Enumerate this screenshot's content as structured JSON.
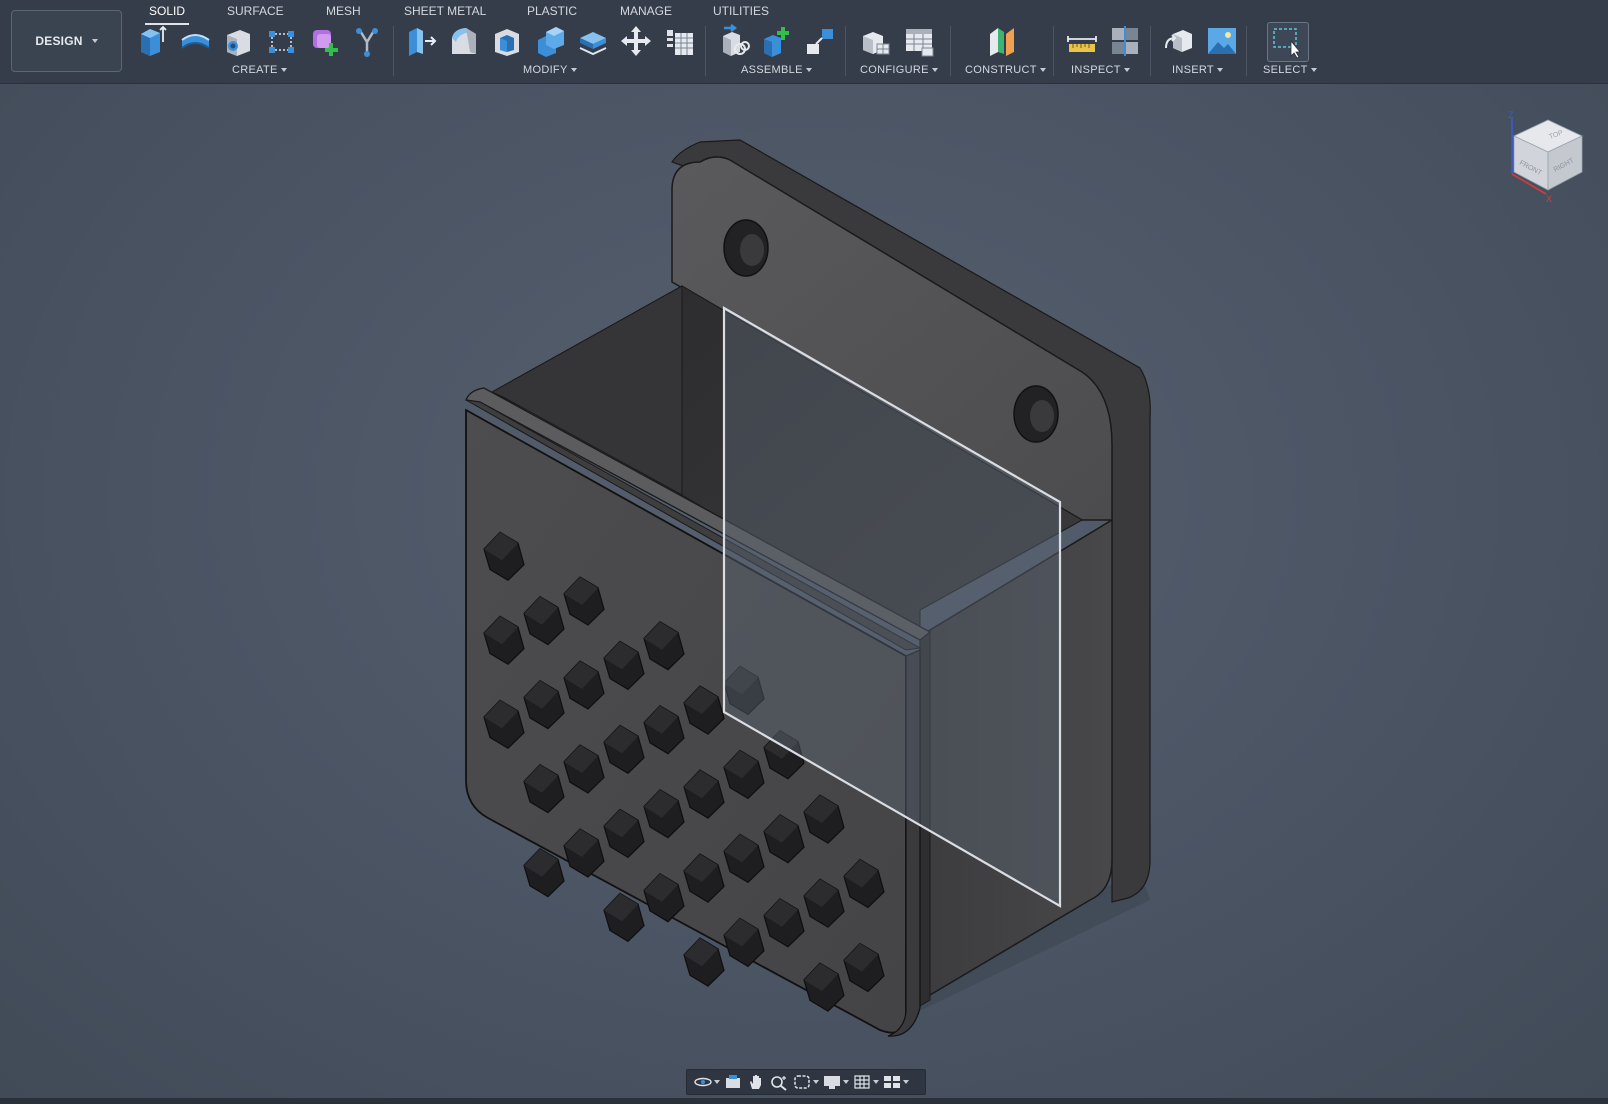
{
  "workspace": {
    "label": "DESIGN"
  },
  "tabs": [
    {
      "label": "SOLID",
      "active": true
    },
    {
      "label": "SURFACE",
      "active": false
    },
    {
      "label": "MESH",
      "active": false
    },
    {
      "label": "SHEET METAL",
      "active": false
    },
    {
      "label": "PLASTIC",
      "active": false
    },
    {
      "label": "MANAGE",
      "active": false
    },
    {
      "label": "UTILITIES",
      "active": false
    }
  ],
  "groups": {
    "create": "CREATE",
    "modify": "MODIFY",
    "assemble": "ASSEMBLE",
    "configure": "CONFIGURE",
    "construct": "CONSTRUCT",
    "inspect": "INSPECT",
    "insert": "INSERT",
    "select": "SELECT"
  },
  "tools": {
    "create": [
      "new-component-icon",
      "extrude-icon",
      "revolve-icon",
      "hole-icon",
      "pattern-icon",
      "create-form-icon",
      "fillet-branch-icon"
    ],
    "modify": [
      "press-pull-icon",
      "fillet-icon",
      "shell-icon",
      "combine-icon",
      "offset-face-icon",
      "move-icon",
      "parameters-icon"
    ],
    "assemble": [
      "joint-icon",
      "new-component-assemble-icon",
      "as-built-joint-icon"
    ],
    "configure": [
      "configure-icon",
      "table-icon"
    ],
    "construct": [
      "plane-icon"
    ],
    "inspect": [
      "measure-icon",
      "section-analysis-icon"
    ],
    "insert": [
      "insert-mesh-icon",
      "insert-image-icon"
    ],
    "select": [
      "window-select-icon"
    ]
  },
  "viewcube": {
    "top": "TOP",
    "front": "FRONT",
    "right": "RIGHT",
    "axis_z": "Z",
    "axis_x": "X"
  },
  "colors": {
    "toolbar_bg": "#353d4a",
    "viewport_bg": "#4b5566",
    "model_body": "#4a4a4b",
    "plane_tint": "#5b6470",
    "accent_blue": "#3b8fd8"
  },
  "nav_tools": [
    "orbit-icon",
    "look-at-icon",
    "pan-icon",
    "zoom-icon",
    "fit-icon",
    "display-settings-icon",
    "grid-icon",
    "viewports-icon"
  ]
}
